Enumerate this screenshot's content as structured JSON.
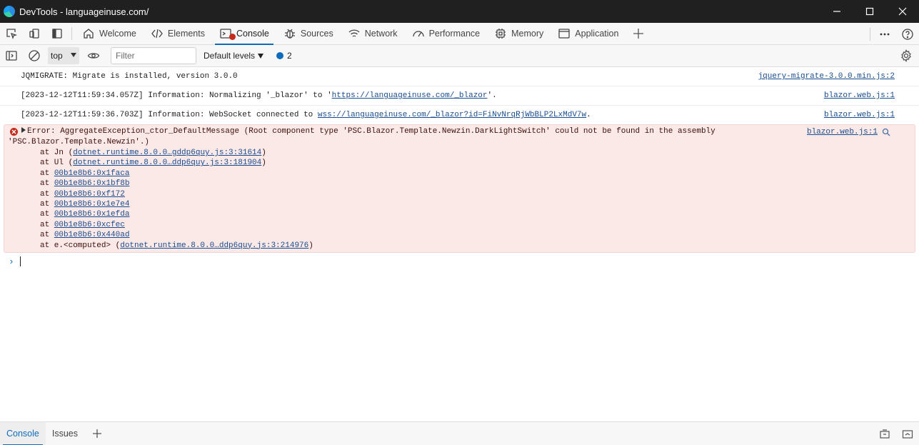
{
  "window": {
    "title": "DevTools - languageinuse.com/"
  },
  "tabs": [
    {
      "label": "Welcome",
      "icon": "home-icon"
    },
    {
      "label": "Elements",
      "icon": "code-icon"
    },
    {
      "label": "Console",
      "icon": "console-icon"
    },
    {
      "label": "Sources",
      "icon": "bug-icon"
    },
    {
      "label": "Network",
      "icon": "wifi-icon"
    },
    {
      "label": "Performance",
      "icon": "gauge-icon"
    },
    {
      "label": "Memory",
      "icon": "chip-icon"
    },
    {
      "label": "Application",
      "icon": "window-icon"
    }
  ],
  "active_tab": "Console",
  "console_toolbar": {
    "context": "top",
    "filter_placeholder": "Filter",
    "levels_label": "Default levels",
    "issues_count": "2"
  },
  "messages": [
    {
      "text": "JQMIGRATE: Migrate is installed, version 3.0.0",
      "source": "jquery-migrate-3.0.0.min.js:2"
    },
    {
      "prefix": "[2023-12-12T11:59:34.057Z] Information: Normalizing '_blazor' to '",
      "link": "https://languageinuse.com/_blazor",
      "suffix": "'.",
      "source": "blazor.web.js:1"
    },
    {
      "prefix": "[2023-12-12T11:59:36.703Z] Information: WebSocket connected to ",
      "link": "wss://languageinuse.com/_blazor?id=FiNvNrqRjWbBLP2LxMdV7w",
      "suffix": ".",
      "source": "blazor.web.js:1"
    }
  ],
  "error": {
    "line1": "Error: AggregateException_ctor_DefaultMessage (Root component type 'PSC.Blazor.Template.Newzin.DarkLightSwitch' could not be found in the assembly",
    "line2": "'PSC.Blazor.Template.Newzin'.)",
    "source": "blazor.web.js:1",
    "stack": [
      {
        "pre": "at Jn (",
        "link": "dotnet.runtime.8.0.0…gddp6quy.js:3:31614",
        "post": ")"
      },
      {
        "pre": "at Ul (",
        "link": "dotnet.runtime.8.0.0…ddp6quy.js:3:181904",
        "post": ")"
      },
      {
        "pre": "at ",
        "link": "00b1e8b6:0x1faca",
        "post": ""
      },
      {
        "pre": "at ",
        "link": "00b1e8b6:0x1bf8b",
        "post": ""
      },
      {
        "pre": "at ",
        "link": "00b1e8b6:0xf172",
        "post": ""
      },
      {
        "pre": "at ",
        "link": "00b1e8b6:0x1e7e4",
        "post": ""
      },
      {
        "pre": "at ",
        "link": "00b1e8b6:0x1efda",
        "post": ""
      },
      {
        "pre": "at ",
        "link": "00b1e8b6:0xcfec",
        "post": ""
      },
      {
        "pre": "at ",
        "link": "00b1e8b6:0x440ad",
        "post": ""
      },
      {
        "pre": "at e.<computed> (",
        "link": "dotnet.runtime.8.0.0…ddp6quy.js:3:214976",
        "post": ")"
      }
    ]
  },
  "drawer": {
    "tabs": [
      "Console",
      "Issues"
    ]
  }
}
